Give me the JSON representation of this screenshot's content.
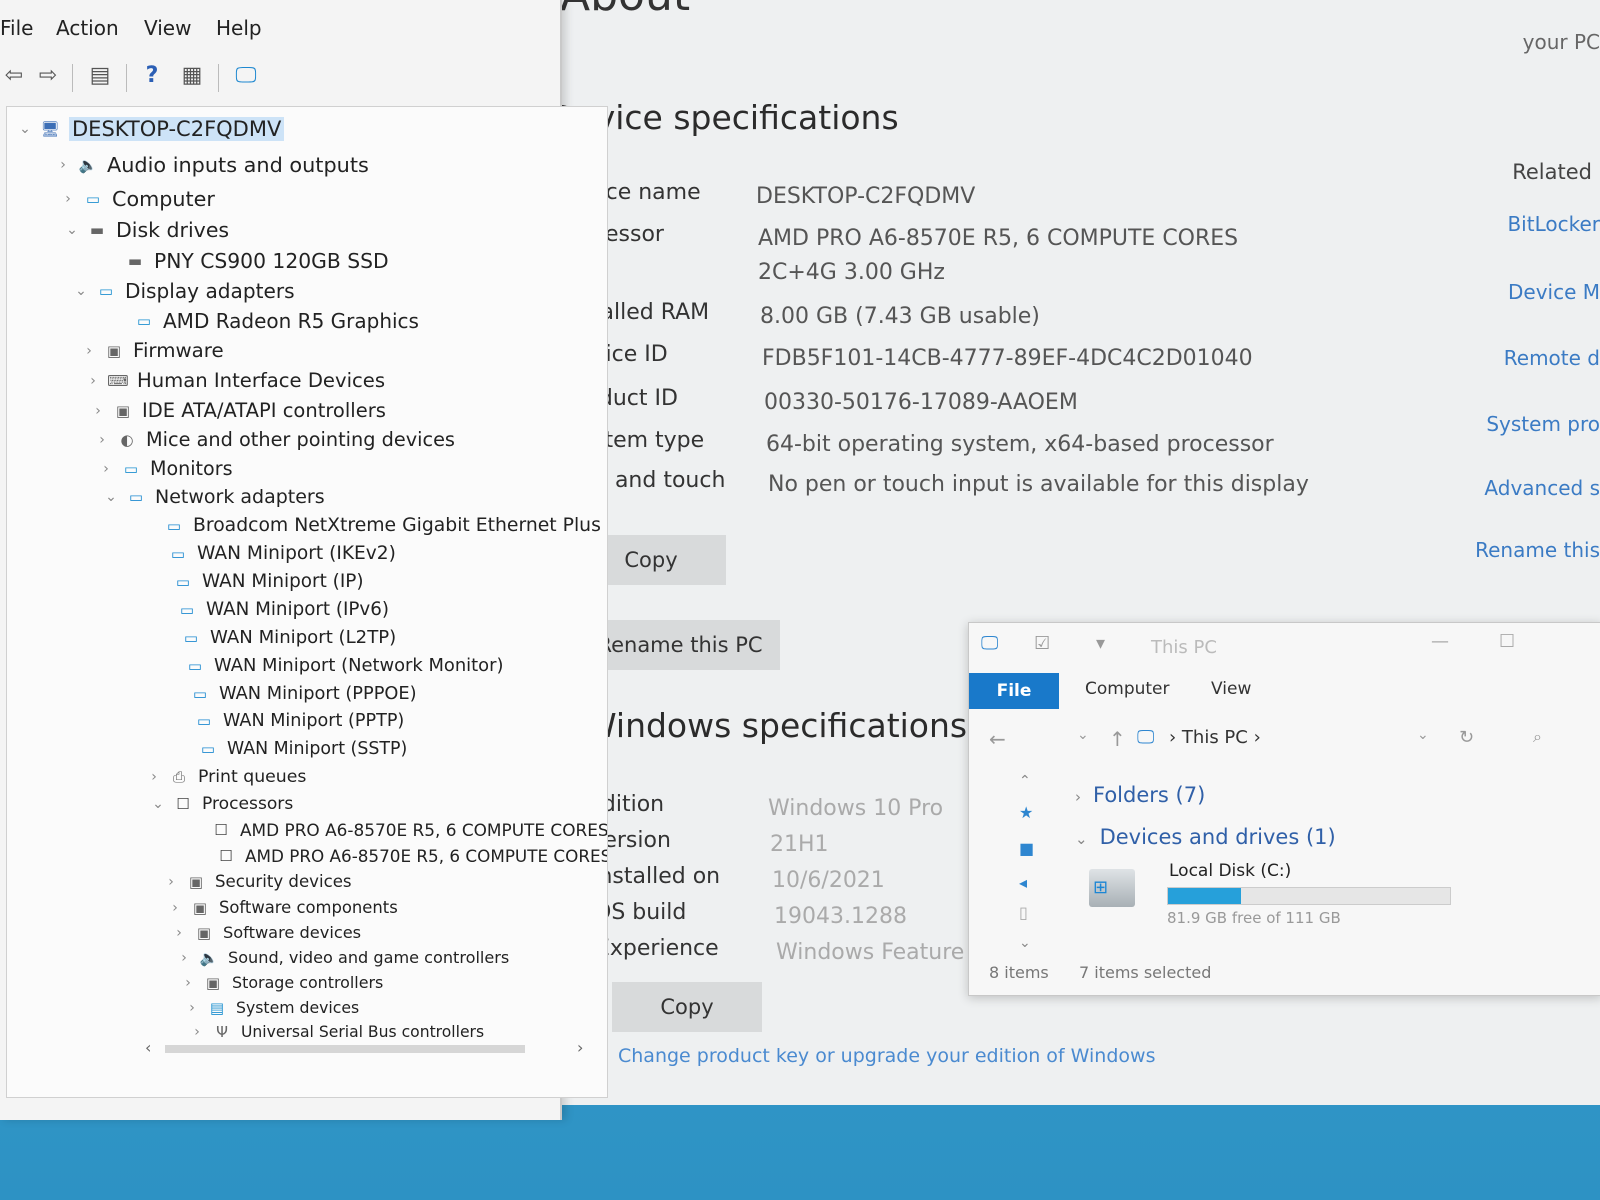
{
  "about": {
    "title": "About",
    "your_pc": "your PC",
    "device_spec_heading": "Device specifications",
    "device_specs": [
      {
        "label": "Device name",
        "value": "DESKTOP-C2FQDMV"
      },
      {
        "label": "Processor",
        "value": "AMD PRO A6-8570E R5, 6 COMPUTE CORES 2C+4G 3.00 GHz"
      },
      {
        "label": "Installed RAM",
        "value": "8.00 GB (7.43 GB usable)"
      },
      {
        "label": "Device ID",
        "value": "FDB5F101-14CB-4777-89EF-4DC4C2D01040"
      },
      {
        "label": "Product ID",
        "value": "00330-50176-17089-AAOEM"
      },
      {
        "label": "System type",
        "value": "64-bit operating system, x64-based processor"
      },
      {
        "label": "Pen and touch",
        "value": "No pen or touch input is available for this display"
      }
    ],
    "copy_label": "Copy",
    "rename_label": "Rename this PC",
    "windows_spec_heading": "Windows specifications",
    "windows_specs": [
      {
        "label": "Edition",
        "value": "Windows 10 Pro"
      },
      {
        "label": "Version",
        "value": "21H1"
      },
      {
        "label": "Installed on",
        "value": "10/6/2021"
      },
      {
        "label": "OS build",
        "value": "19043.1288"
      },
      {
        "label": "Experience",
        "value": "Windows Feature Ex"
      }
    ],
    "copy2_label": "Copy",
    "bottom_link": "Change product key or upgrade your edition of Windows",
    "related_heading": "Related",
    "related_links": [
      "BitLocker",
      "Device M",
      "Remote d",
      "System pro",
      "Advanced s",
      "Rename this"
    ]
  },
  "device_manager": {
    "menu": [
      "File",
      "Action",
      "View",
      "Help"
    ],
    "tree": [
      {
        "label": "DESKTOP-C2FQDMV",
        "chev": "v",
        "icon": "pc"
      },
      {
        "label": "Audio inputs and outputs",
        "chev": ">",
        "icon": "speaker"
      },
      {
        "label": "Computer",
        "chev": ">",
        "icon": "monitor"
      },
      {
        "label": "Disk drives",
        "chev": "v",
        "icon": "disk"
      },
      {
        "label": "PNY CS900 120GB SSD",
        "chev": "",
        "icon": "disk"
      },
      {
        "label": "Display adapters",
        "chev": "v",
        "icon": "monitor"
      },
      {
        "label": "AMD Radeon R5 Graphics",
        "chev": "",
        "icon": "monitor"
      },
      {
        "label": "Firmware",
        "chev": ">",
        "icon": "chip"
      },
      {
        "label": "Human Interface Devices",
        "chev": ">",
        "icon": "hid"
      },
      {
        "label": "IDE ATA/ATAPI controllers",
        "chev": ">",
        "icon": "chip"
      },
      {
        "label": "Mice and other pointing devices",
        "chev": ">",
        "icon": "mouse"
      },
      {
        "label": "Monitors",
        "chev": ">",
        "icon": "monitor"
      },
      {
        "label": "Network adapters",
        "chev": "v",
        "icon": "net"
      },
      {
        "label": "Broadcom NetXtreme Gigabit Ethernet Plus",
        "chev": "",
        "icon": "net"
      },
      {
        "label": "WAN Miniport (IKEv2)",
        "chev": "",
        "icon": "net"
      },
      {
        "label": "WAN Miniport (IP)",
        "chev": "",
        "icon": "net"
      },
      {
        "label": "WAN Miniport (IPv6)",
        "chev": "",
        "icon": "net"
      },
      {
        "label": "WAN Miniport (L2TP)",
        "chev": "",
        "icon": "net"
      },
      {
        "label": "WAN Miniport (Network Monitor)",
        "chev": "",
        "icon": "net"
      },
      {
        "label": "WAN Miniport (PPPOE)",
        "chev": "",
        "icon": "net"
      },
      {
        "label": "WAN Miniport (PPTP)",
        "chev": "",
        "icon": "net"
      },
      {
        "label": "WAN Miniport (SSTP)",
        "chev": "",
        "icon": "net"
      },
      {
        "label": "Print queues",
        "chev": ">",
        "icon": "printer"
      },
      {
        "label": "Processors",
        "chev": "v",
        "icon": "cpu"
      },
      {
        "label": "AMD PRO A6-8570E R5, 6 COMPUTE CORES",
        "chev": "",
        "icon": "cpu"
      },
      {
        "label": "AMD PRO A6-8570E R5, 6 COMPUTE CORES",
        "chev": "",
        "icon": "cpu"
      },
      {
        "label": "Security devices",
        "chev": ">",
        "icon": "chip"
      },
      {
        "label": "Software components",
        "chev": ">",
        "icon": "chip"
      },
      {
        "label": "Software devices",
        "chev": ">",
        "icon": "chip"
      },
      {
        "label": "Sound, video and game controllers",
        "chev": ">",
        "icon": "speaker"
      },
      {
        "label": "Storage controllers",
        "chev": ">",
        "icon": "chip"
      },
      {
        "label": "System devices",
        "chev": ">",
        "icon": "folder"
      },
      {
        "label": "Universal Serial Bus controllers",
        "chev": ">",
        "icon": "usb"
      }
    ]
  },
  "explorer": {
    "title": "This PC",
    "tabs": {
      "file": "File",
      "computer": "Computer",
      "view": "View"
    },
    "path": "This PC",
    "folders_group": "Folders (7)",
    "devices_group": "Devices and drives (1)",
    "drive_name": "Local Disk (C:)",
    "drive_free": "81.9 GB free of 111 GB",
    "drive_used_fraction": 0.26,
    "status_items": "8 items",
    "status_selected": "7 items selected"
  },
  "colors": {
    "accent": "#1979ca",
    "link": "#3b7bc4",
    "desktop": "#2d92c4"
  }
}
